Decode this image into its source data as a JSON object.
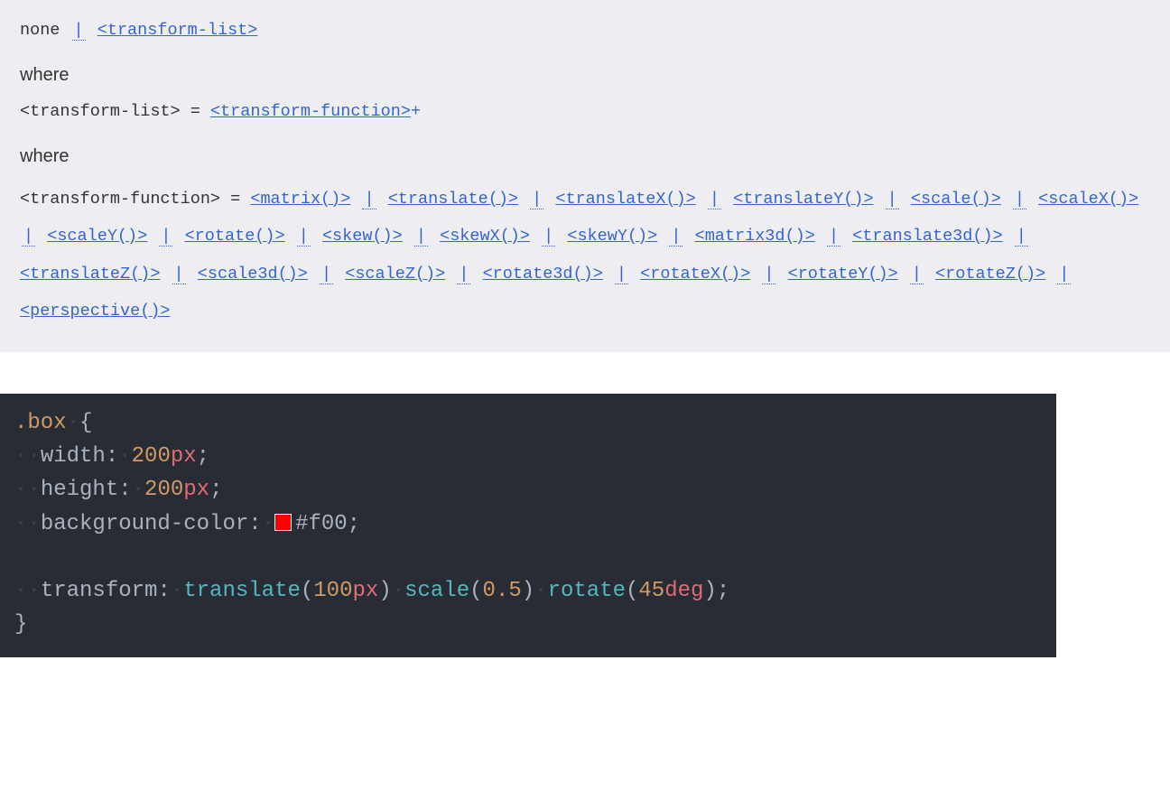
{
  "syntax": {
    "line1": {
      "none": "none",
      "pipe": "|",
      "transform_list": "<transform-list>"
    },
    "where1": "where",
    "line2": {
      "lhs": "<transform-list> = ",
      "transform_function": "<transform-function>",
      "plus": "+"
    },
    "where2": "where",
    "line3_prefix": "<transform-function> = ",
    "funcs": [
      "<matrix()>",
      "<translate()>",
      "<translateX()>",
      "<translateY()>",
      "<scale()>",
      "<scaleX()>",
      "<scaleY()>",
      "<rotate()>",
      "<skew()>",
      "<skewX()>",
      "<skewY()>",
      "<matrix3d()>",
      "<translate3d()>",
      "<translateZ()>",
      "<scale3d()>",
      "<scaleZ()>",
      "<rotate3d()>",
      "<rotateX()>",
      "<rotateY()>",
      "<rotateZ()>",
      "<perspective()>"
    ],
    "pipe": "|"
  },
  "code": {
    "selector": ".box",
    "brace_open": "{",
    "brace_close": "}",
    "dot": "·",
    "width": {
      "prop": "width",
      "colon": ":",
      "num": "200",
      "unit": "px",
      "semi": ";"
    },
    "height": {
      "prop": "height",
      "colon": ":",
      "num": "200",
      "unit": "px",
      "semi": ";"
    },
    "bg": {
      "prop": "background-color",
      "colon": ":",
      "hex": "#f00",
      "semi": ";"
    },
    "transform": {
      "prop": "transform",
      "colon": ":",
      "f1": "translate",
      "p1o": "(",
      "n1": "100",
      "u1": "px",
      "p1c": ")",
      "f2": "scale",
      "p2o": "(",
      "n2": "0.5",
      "p2c": ")",
      "f3": "rotate",
      "p3o": "(",
      "n3": "45",
      "u3": "deg",
      "p3c": ")",
      "semi": ";"
    }
  }
}
